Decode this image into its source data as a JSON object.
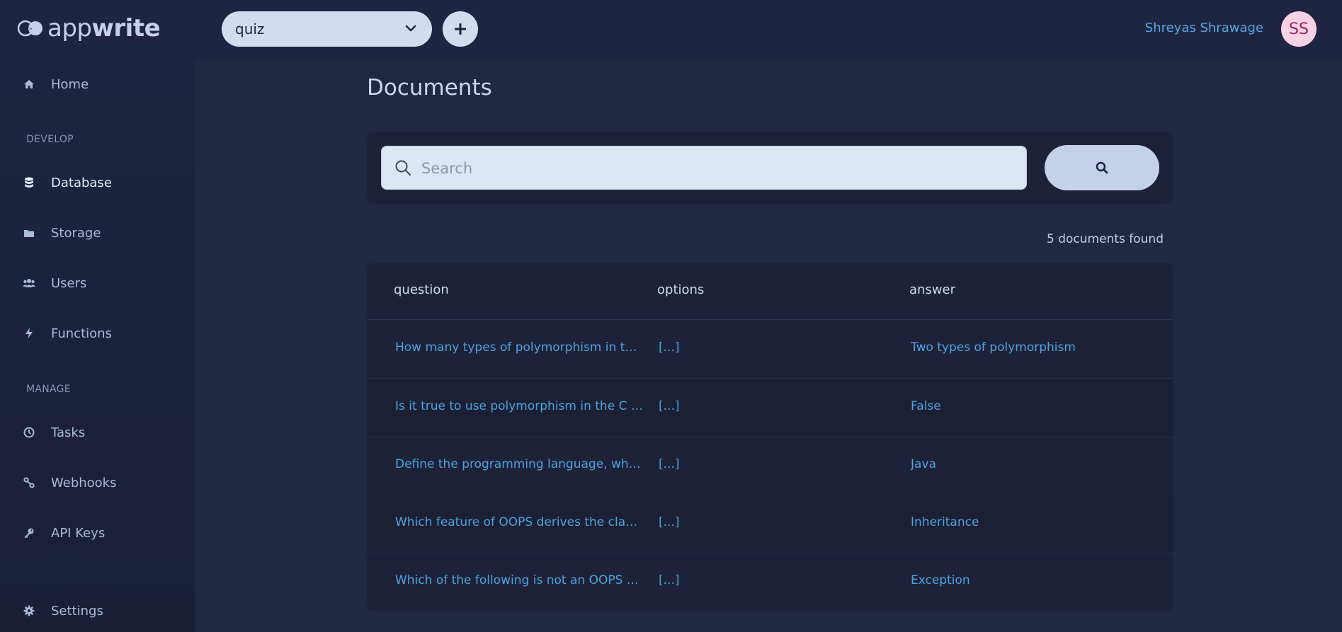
{
  "app": {
    "logo_light": "app",
    "logo_bold": "write"
  },
  "sidebar": {
    "home": "Home",
    "develop_label": "DEVELOP",
    "database": "Database",
    "storage": "Storage",
    "users": "Users",
    "functions": "Functions",
    "manage_label": "MANAGE",
    "tasks": "Tasks",
    "webhooks": "Webhooks",
    "api_keys": "API Keys",
    "settings": "Settings"
  },
  "header": {
    "project": "quiz",
    "user_name": "Shreyas Shrawage",
    "avatar_initials": "SS"
  },
  "main": {
    "title": "Documents",
    "search_placeholder": "Search",
    "count_text": "5 documents found",
    "columns": [
      "question",
      "options",
      "answer"
    ],
    "rows": [
      {
        "question": "How many types of polymorphism in th...",
        "options": "[...]",
        "answer": "Two types of polymorphism"
      },
      {
        "question": "Is it true to use polymorphism in the C pr...",
        "options": "[...]",
        "answer": "False"
      },
      {
        "question": "Define the programming language, whi...",
        "options": "[...]",
        "answer": "Java"
      },
      {
        "question": "Which feature of OOPS derives the class ...",
        "options": "[...]",
        "answer": "Inheritance"
      },
      {
        "question": "Which of the following is not an OOPS co...",
        "options": "[...]",
        "answer": "Exception"
      }
    ]
  },
  "colors": {
    "accent": "#56a8e0",
    "bg": "#222840",
    "sidebar": "#1f2540",
    "avatar_bg": "#f6d2e4",
    "avatar_fg": "#9c2262"
  }
}
